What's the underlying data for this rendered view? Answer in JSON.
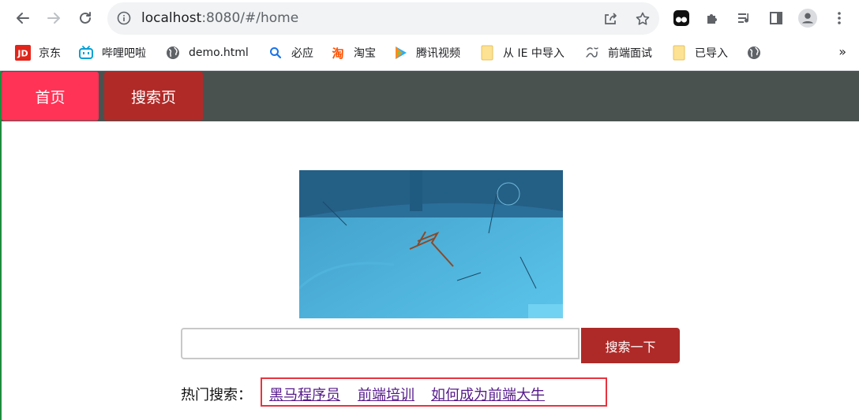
{
  "browser": {
    "url_host": "localhost",
    "url_rest": ":8080/#/home",
    "icons": {
      "back": "back-arrow-icon",
      "forward": "forward-arrow-icon",
      "reload": "reload-icon",
      "site_info": "info-icon",
      "share": "share-icon",
      "bookmark_star": "star-icon",
      "extension_1": "tampermonkey-icon",
      "extensions": "puzzle-icon",
      "reading_list": "media-queue-icon",
      "side_panel": "side-panel-icon",
      "profile": "profile-avatar-icon",
      "menu": "kebab-menu-icon"
    }
  },
  "bookmarks": {
    "items": [
      {
        "label": "京东",
        "icon": "jd-logo-icon"
      },
      {
        "label": "哔哩吧啦",
        "icon": "bilibili-tv-icon"
      },
      {
        "label": "demo.html",
        "icon": "globe-icon"
      },
      {
        "label": "必应",
        "icon": "bing-search-icon"
      },
      {
        "label": "淘宝",
        "icon": "taobao-logo-icon"
      },
      {
        "label": "腾讯视频",
        "icon": "tencent-video-play-icon"
      },
      {
        "label": "从 IE 中导入",
        "icon": "folder-icon"
      },
      {
        "label": "前端面试",
        "icon": "dragon-icon"
      },
      {
        "label": "已导入",
        "icon": "folder-icon"
      },
      {
        "label": "",
        "icon": "globe-icon"
      }
    ],
    "more": "»"
  },
  "page": {
    "nav": {
      "home_label": "首页",
      "search_label": "搜索页"
    },
    "search": {
      "input_value": "",
      "button_label": "搜索一下"
    },
    "hot": {
      "label": "热门搜索：",
      "links": [
        "黑马程序员",
        "前端培训",
        "如何成为前端大牛"
      ]
    },
    "colors": {
      "nav_bg": "#4a5250",
      "home_tab": "#ff3356",
      "search_tab": "#b02a28",
      "button": "#ae2a28",
      "highlight_border": "#e8333f",
      "link": "#551a8b"
    }
  }
}
